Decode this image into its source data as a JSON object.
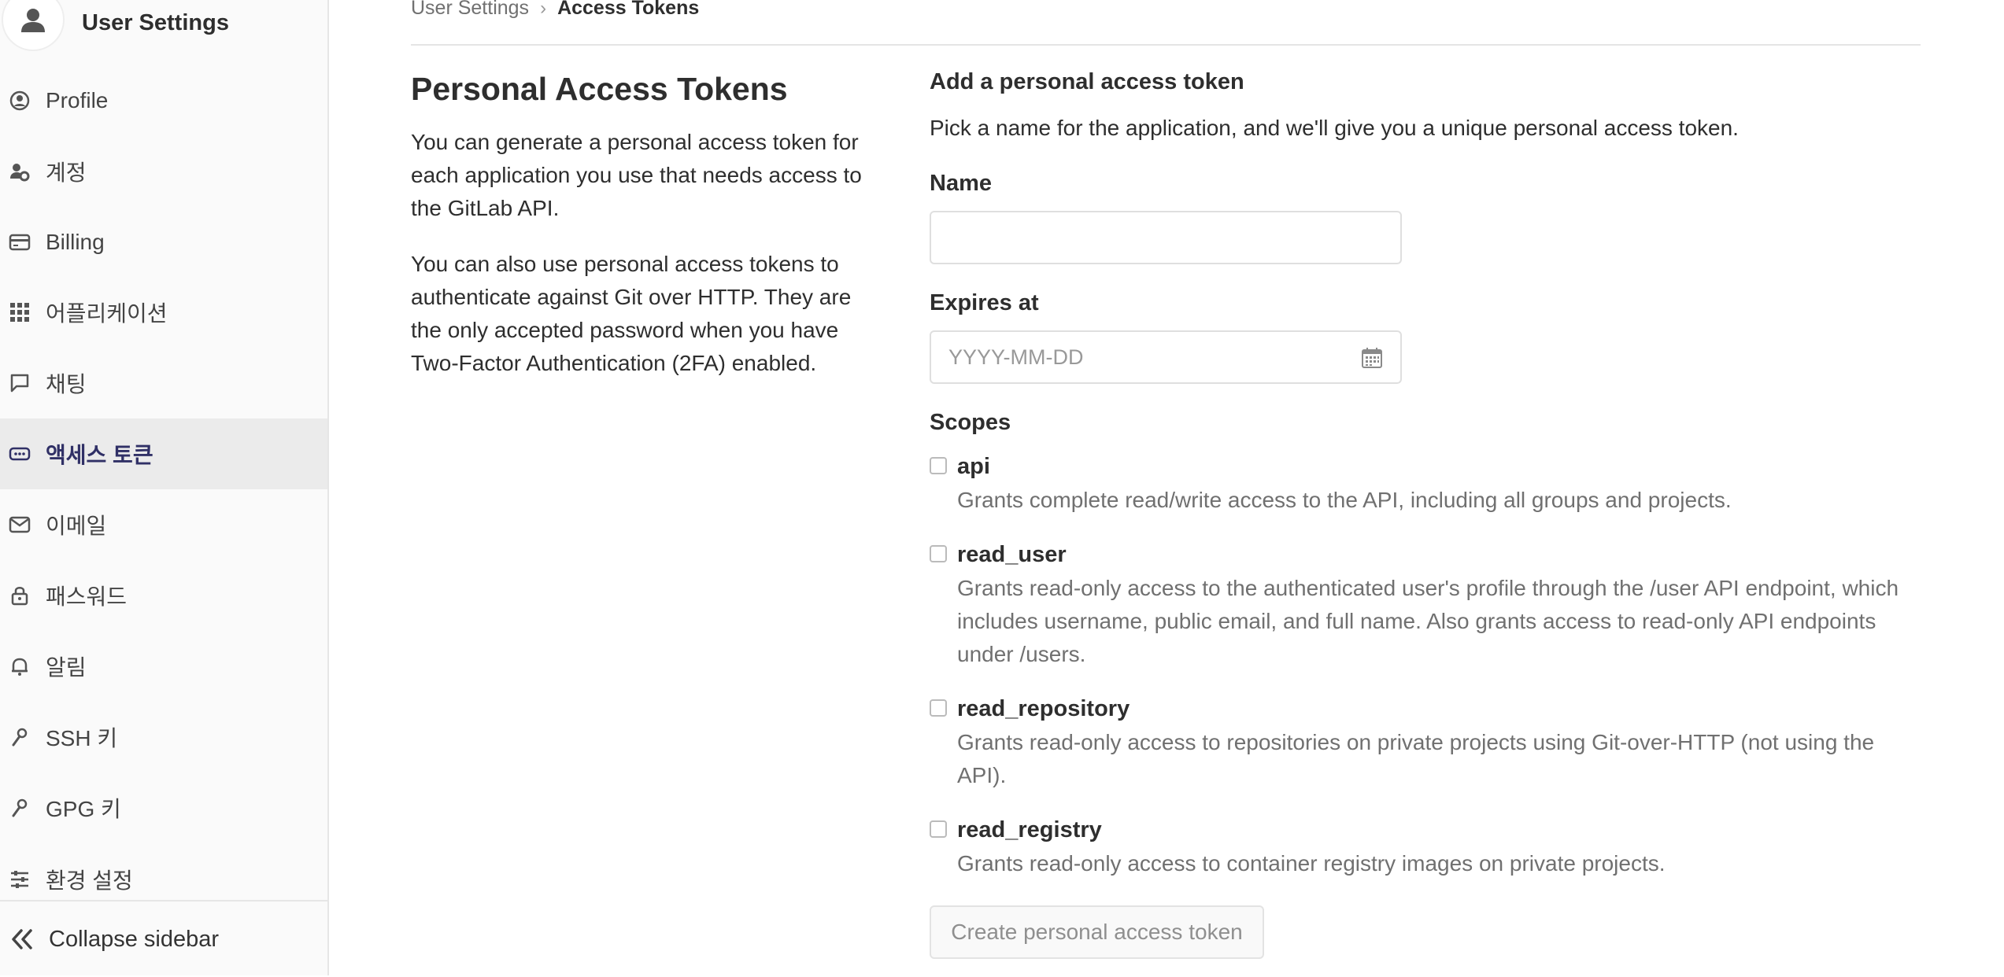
{
  "sidebar": {
    "title": "User Settings",
    "items": [
      {
        "label": "Profile",
        "icon": "profile-icon",
        "active": false
      },
      {
        "label": "계정",
        "icon": "account-icon",
        "active": false
      },
      {
        "label": "Billing",
        "icon": "billing-icon",
        "active": false
      },
      {
        "label": "어플리케이션",
        "icon": "applications-icon",
        "active": false
      },
      {
        "label": "채팅",
        "icon": "chat-icon",
        "active": false
      },
      {
        "label": "액세스 토큰",
        "icon": "token-icon",
        "active": true
      },
      {
        "label": "이메일",
        "icon": "email-icon",
        "active": false
      },
      {
        "label": "패스워드",
        "icon": "lock-icon",
        "active": false
      },
      {
        "label": "알림",
        "icon": "bell-icon",
        "active": false
      },
      {
        "label": "SSH 키",
        "icon": "key-icon",
        "active": false
      },
      {
        "label": "GPG 키",
        "icon": "key-icon",
        "active": false
      },
      {
        "label": "환경 설정",
        "icon": "preferences-icon",
        "active": false
      }
    ],
    "collapse_label": "Collapse sidebar"
  },
  "breadcrumb": {
    "parent": "User Settings",
    "separator": "›",
    "current": "Access Tokens"
  },
  "intro": {
    "title": "Personal Access Tokens",
    "paragraph1": "You can generate a personal access token for each application you use that needs access to the GitLab API.",
    "paragraph2": "You can also use personal access tokens to authenticate against Git over HTTP. They are the only accepted password when you have Two-Factor Authentication (2FA) enabled."
  },
  "form": {
    "title": "Add a personal access token",
    "subtitle": "Pick a name for the application, and we'll give you a unique personal access token.",
    "name_label": "Name",
    "name_value": "",
    "expires_label": "Expires at",
    "expires_placeholder": "YYYY-MM-DD",
    "scopes_label": "Scopes",
    "scopes": [
      {
        "name": "api",
        "checked": false,
        "description": "Grants complete read/write access to the API, including all groups and projects."
      },
      {
        "name": "read_user",
        "checked": false,
        "description": "Grants read-only access to the authenticated user's profile through the /user API endpoint, which includes username, public email, and full name. Also grants access to read-only API endpoints under /users."
      },
      {
        "name": "read_repository",
        "checked": false,
        "description": "Grants read-only access to repositories on private projects using Git-over-HTTP (not using the API)."
      },
      {
        "name": "read_registry",
        "checked": false,
        "description": "Grants read-only access to container registry images on private projects."
      }
    ],
    "submit_label": "Create personal access token"
  },
  "colors": {
    "active_item_bg": "#ebebeb",
    "active_item_text": "#303066",
    "muted_text": "#707070"
  }
}
